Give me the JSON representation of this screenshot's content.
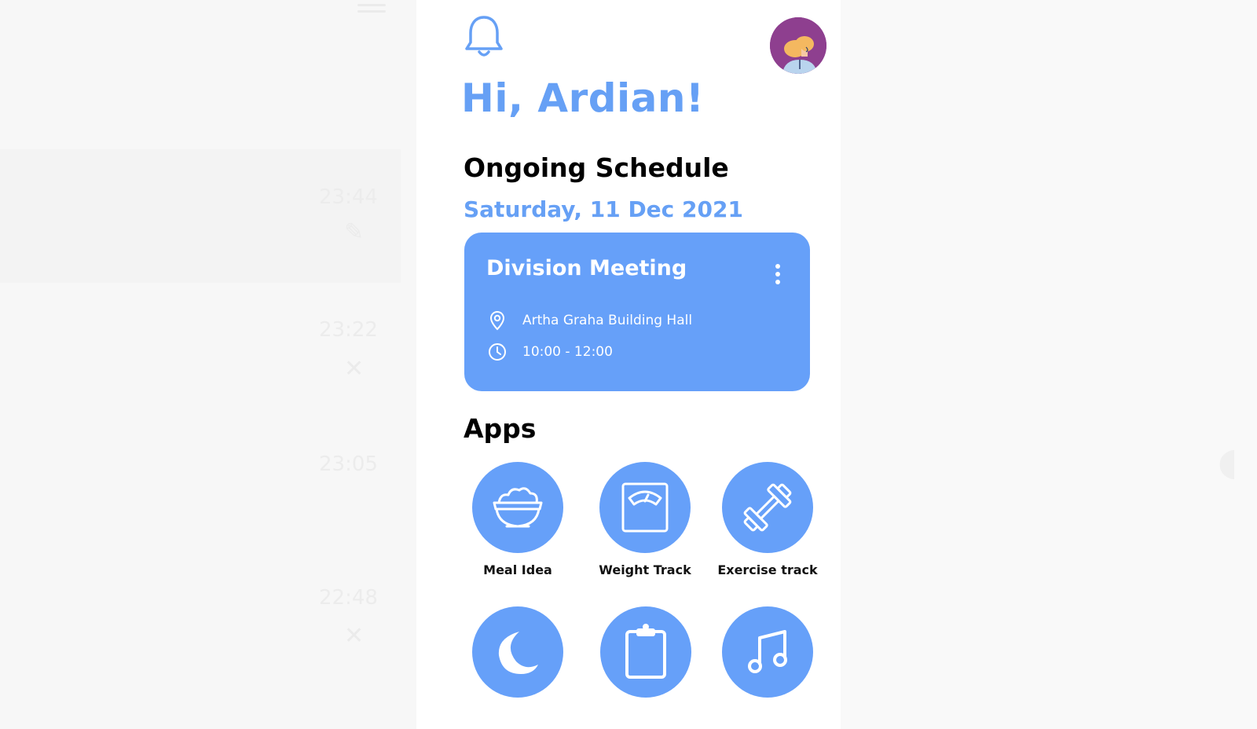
{
  "greeting": "Hi, Ardian!",
  "schedule": {
    "section_title": "Ongoing Schedule",
    "date": "Saturday, 11 Dec 2021",
    "event": {
      "title": "Division Meeting",
      "location": "Artha Graha Building Hall",
      "time": "10:00 - 12:00"
    }
  },
  "apps": {
    "section_title": "Apps",
    "items": [
      {
        "label": "Meal Idea",
        "icon": "bowl-icon"
      },
      {
        "label": "Weight Track",
        "icon": "scale-icon"
      },
      {
        "label": "Exercise track",
        "icon": "dumbbell-icon"
      },
      {
        "label": "",
        "icon": "moon-icon"
      },
      {
        "label": "",
        "icon": "clipboard-icon"
      },
      {
        "label": "",
        "icon": "music-note-icon"
      }
    ]
  },
  "background": {
    "times": [
      "23:44",
      "23:22",
      "23:05",
      "22:48"
    ]
  },
  "colors": {
    "accent": "#66a0f9",
    "avatar_bg": "#8e3f8f",
    "text": "#000000"
  }
}
